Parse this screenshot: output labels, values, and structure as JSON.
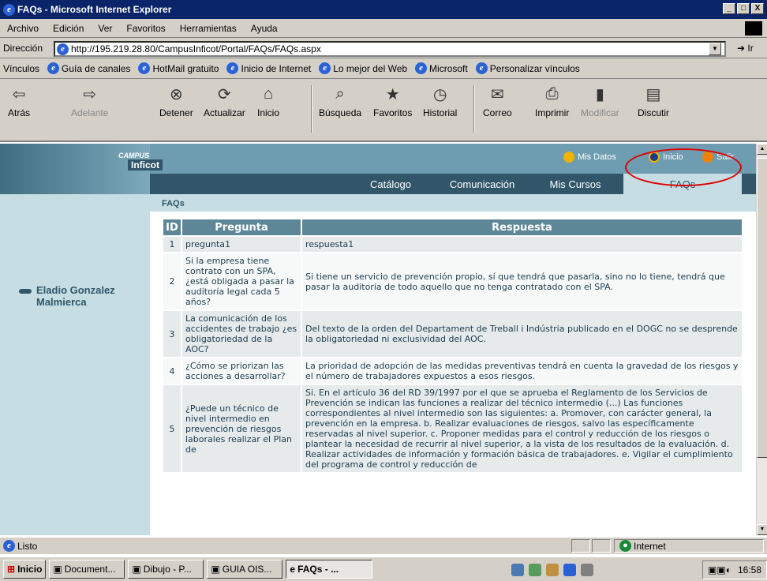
{
  "window": {
    "title": "FAQs - Microsoft Internet Explorer",
    "buttons": [
      "_",
      "□",
      "X"
    ]
  },
  "menu": [
    "Archivo",
    "Edición",
    "Ver",
    "Favoritos",
    "Herramientas",
    "Ayuda"
  ],
  "address": {
    "label": "Dirección",
    "url": "http://195.219.28.80/CampusInficot/Portal/FAQs/FAQs.aspx",
    "go": "Ir"
  },
  "links": {
    "label": "Vínculos",
    "items": [
      "Guía de canales",
      "HotMail gratuito",
      "Inicio de Internet",
      "Lo mejor del Web",
      "Microsoft",
      "Personalizar vínculos"
    ]
  },
  "toolbar": {
    "back": "Atrás",
    "forward": "Adelante",
    "stop": "Detener",
    "refresh": "Actualizar",
    "home": "Inicio",
    "search": "Búsqueda",
    "favorites": "Favoritos",
    "history": "Historial",
    "mail": "Correo",
    "print": "Imprimir",
    "edit": "Modificar",
    "discuss": "Discutir"
  },
  "site": {
    "campus": "CAMPUS",
    "brand": "Inficot",
    "top_links": {
      "mis_datos": "Mis Datos",
      "inicio": "Inicio",
      "salir": "Salir"
    },
    "tabs": [
      "Catálogo",
      "Comunicación",
      "Mis Cursos",
      "FAQs"
    ],
    "user": "Eladio Gonzalez Malmierca",
    "section": "FAQs",
    "headers": {
      "id": "ID",
      "pregunta": "Pregunta",
      "respuesta": "Respuesta"
    },
    "rows": [
      {
        "id": "1",
        "q": "pregunta1",
        "a": "respuesta1"
      },
      {
        "id": "2",
        "q": "Si la empresa tiene contrato con un SPA, ¿está obligada a pasar la auditoría legal cada 5 años?",
        "a": "Si tiene un servicio de prevención propio, sí que tendrá que pasarla, sino no lo tiene, tendrá que pasar la auditoría de todo aquello que no tenga contratado con el SPA."
      },
      {
        "id": "3",
        "q": "La comunicación de los accidentes de trabajo ¿es obligatoriedad de la AOC?",
        "a": "Del texto de la orden del Departament de Treball i Indústria publicado en el DOGC no se desprende la obligatoriedad ni exclusividad del AOC."
      },
      {
        "id": "4",
        "q": "¿Cómo se priorizan las acciones a desarrollar?",
        "a": "La prioridad de adopción de las medidas preventivas tendrá en cuenta la gravedad de los riesgos y el número de trabajadores expuestos a esos riesgos."
      },
      {
        "id": "5",
        "q": "¿Puede un técnico de nivel intermedio en prevención de riesgos laborales realizar el Plan de",
        "a": "Si. En el artículo 36 del RD 39/1997 por el que se aprueba el Reglamento de los Servicios de Prevención se indican las funciones a realizar del técnico intermedio (...) Las funciones correspondientes al nivel intermedio son las siguientes: a. Promover, con carácter general, la prevención en la empresa. b. Realizar evaluaciones de riesgos, salvo las específicamente reservadas al nivel superior. c. Proponer medidas para el control y reducción de los riesgos o plantear la necesidad de recurrir al nivel superior, a la vista de los resultados de la evaluación. d. Realizar actividades de información y formación básica de trabajadores. e. Vigilar el cumplimiento del programa de control y reducción de"
      }
    ]
  },
  "status": {
    "text": "Listo",
    "zone": "Internet"
  },
  "taskbar": {
    "start": "Inicio",
    "tasks": [
      "Document...",
      "Dibujo - P...",
      "GUIA OIS...",
      "FAQs - ..."
    ],
    "clock": "16:58"
  },
  "colors": {
    "dark_teal": "#31566a",
    "light_teal": "#c5dde3",
    "header": "#5d8797",
    "title_blue": "#0a246a",
    "oval": "#e00000"
  }
}
